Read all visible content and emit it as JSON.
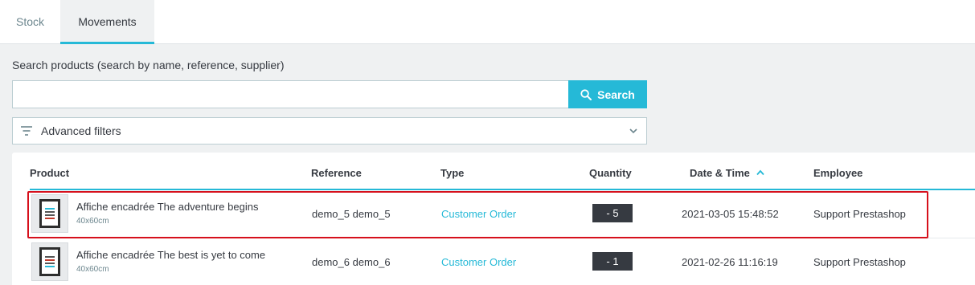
{
  "tabs": [
    {
      "label": "Stock",
      "active": false
    },
    {
      "label": "Movements",
      "active": true
    }
  ],
  "search": {
    "label": "Search products (search by name, reference, supplier)",
    "value": "",
    "placeholder": "",
    "button_label": "Search",
    "button_icon": "search-icon"
  },
  "filters": {
    "label": "Advanced filters",
    "icon": "filter-icon",
    "toggle_icon": "chevron-down-icon"
  },
  "table": {
    "columns": [
      "Product",
      "Reference",
      "Type",
      "Quantity",
      "Date & Time",
      "Employee"
    ],
    "sorted_column": "Date & Time",
    "sort_direction": "ascending",
    "rows": [
      {
        "product_name": "Affiche encadrée The adventure begins",
        "combination": "40x60cm",
        "reference": "demo_5 demo_5",
        "type": "Customer Order",
        "quantity": "- 5",
        "date_time": "2021-03-05 15:48:52",
        "employee": "Support Prestashop",
        "highlighted": true
      },
      {
        "product_name": "Affiche encadrée The best is yet to come",
        "combination": "40x60cm",
        "reference": "demo_6 demo_6",
        "type": "Customer Order",
        "quantity": "- 1",
        "date_time": "2021-02-26 11:16:19",
        "employee": "Support Prestashop",
        "highlighted": false
      }
    ]
  },
  "colors": {
    "accent": "#25b9d7",
    "highlight_border": "#d6101c",
    "quantity_badge": "#363a41"
  }
}
